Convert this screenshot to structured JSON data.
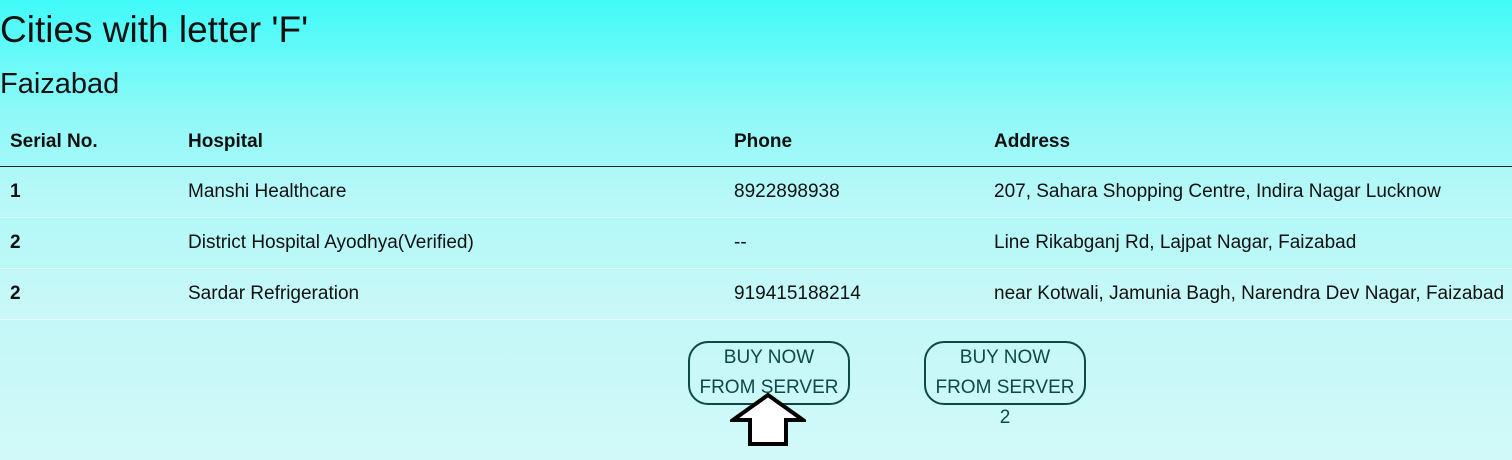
{
  "page": {
    "title": "Cities with letter 'F'",
    "city": "Faizabad"
  },
  "table": {
    "headers": {
      "serial": "Serial No.",
      "hospital": "Hospital",
      "phone": "Phone",
      "address": "Address"
    },
    "rows": [
      {
        "serial": "1",
        "hospital": "Manshi Healthcare",
        "phone": "8922898938",
        "address": "207, Sahara Shopping Centre, Indira Nagar Lucknow"
      },
      {
        "serial": "2",
        "hospital": "District Hospital Ayodhya(Verified)",
        "phone": "--",
        "address": "Line Rikabganj Rd, Lajpat Nagar, Faizabad"
      },
      {
        "serial": "2",
        "hospital": "Sardar Refrigeration",
        "phone": "919415188214",
        "address": "near Kotwali, Jamunia Bagh, Narendra Dev Nagar, Faizabad"
      }
    ]
  },
  "buttons": {
    "server1": "BUY NOW FROM SERVER 1",
    "server2": "BUY NOW FROM SERVER 2"
  },
  "icons": {
    "pointer": "up-arrow-icon"
  },
  "colors": {
    "background_top": "#40fbf8",
    "background_bottom": "#d2f9f9",
    "button_border": "#0d4a44"
  }
}
